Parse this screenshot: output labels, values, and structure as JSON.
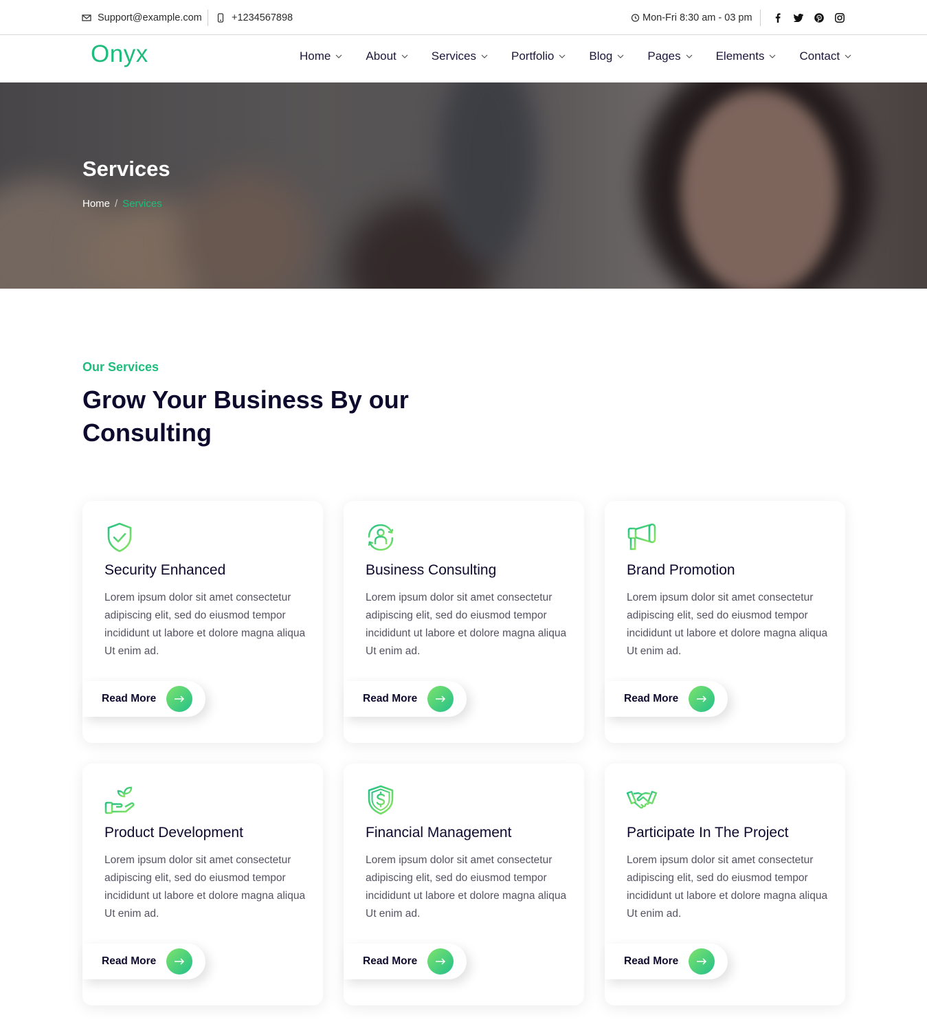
{
  "topbar": {
    "email": "Support@example.com",
    "phone": "+1234567898",
    "hours": "Mon-Fri 8:30 am - 03 pm",
    "social": [
      "facebook-icon",
      "twitter-icon",
      "pinterest-icon",
      "instagram-icon"
    ]
  },
  "header": {
    "logo": "Onyx",
    "nav": [
      "Home",
      "About",
      "Services",
      "Portfolio",
      "Blog",
      "Pages",
      "Elements",
      "Contact"
    ]
  },
  "hero": {
    "title": "Services",
    "breadcrumb_home": "Home",
    "breadcrumb_sep": "/",
    "breadcrumb_current": "Services"
  },
  "section": {
    "eyebrow": "Our Services",
    "title": "Grow Your Business By our Consulting"
  },
  "cards": [
    {
      "icon": "shield-check-icon",
      "title": "Security Enhanced",
      "text": "Lorem ipsum dolor sit amet consectetur adipiscing elit, sed do eiusmod tempor incididunt ut labore et dolore magna aliqua Ut enim ad.",
      "button": "Read More"
    },
    {
      "icon": "consulting-person-icon",
      "title": "Business Consulting",
      "text": "Lorem ipsum dolor sit amet consectetur adipiscing elit, sed do eiusmod tempor incididunt ut labore et dolore magna aliqua Ut enim ad.",
      "button": "Read More"
    },
    {
      "icon": "megaphone-icon",
      "title": "Brand Promotion",
      "text": "Lorem ipsum dolor sit amet consectetur adipiscing elit, sed do eiusmod tempor incididunt ut labore et dolore magna aliqua Ut enim ad.",
      "button": "Read More"
    },
    {
      "icon": "hand-plant-icon",
      "title": "Product Development",
      "text": "Lorem ipsum dolor sit amet consectetur adipiscing elit, sed do eiusmod tempor incididunt ut labore et dolore magna aliqua Ut enim ad.",
      "button": "Read More"
    },
    {
      "icon": "shield-dollar-icon",
      "title": "Financial Management",
      "text": "Lorem ipsum dolor sit amet consectetur adipiscing elit, sed do eiusmod tempor incididunt ut labore et dolore magna aliqua Ut enim ad.",
      "button": "Read More"
    },
    {
      "icon": "handshake-icon",
      "title": "Participate In The Project",
      "text": "Lorem ipsum dolor sit amet consectetur adipiscing elit, sed do eiusmod tempor incididunt ut labore et dolore magna aliqua Ut enim ad.",
      "button": "Read More"
    }
  ],
  "colors": {
    "accent": "#1fbd7d",
    "gradient_start": "#7ee36b",
    "gradient_end": "#22c08a",
    "heading": "#0e0a2e"
  }
}
